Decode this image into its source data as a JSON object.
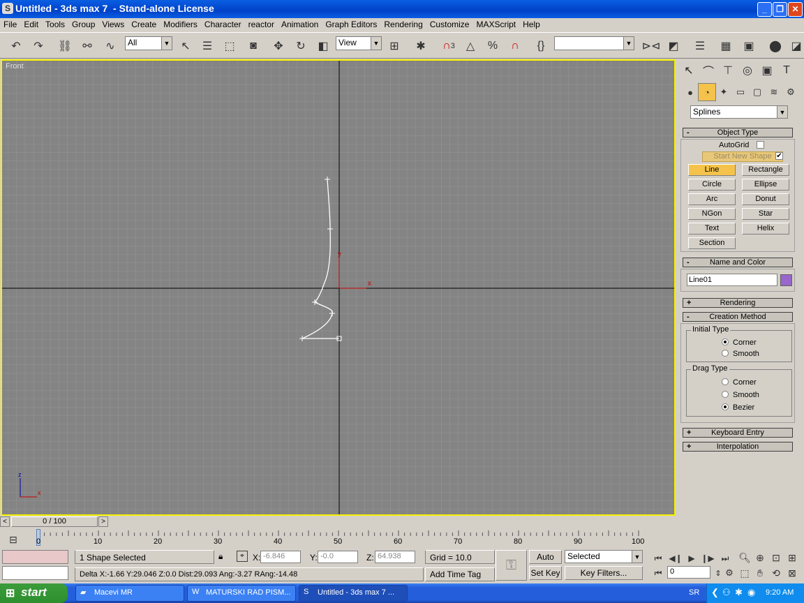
{
  "window": {
    "title": "Untitled - 3ds max 7  - Stand-alone License",
    "minimize": "_",
    "maximize": "❐",
    "close": "✕"
  },
  "menu": [
    "File",
    "Edit",
    "Tools",
    "Group",
    "Views",
    "Create",
    "Modifiers",
    "Character",
    "reactor",
    "Animation",
    "Graph Editors",
    "Rendering",
    "Customize",
    "MAXScript",
    "Help"
  ],
  "toolbar": {
    "selection_filter": "All",
    "reference_coord": "View",
    "snap_label": "3",
    "angle_snap": "%",
    "named_selection": ""
  },
  "viewport": {
    "label": "Front",
    "axis_x": "x",
    "axis_y": "y",
    "corner_z": "z",
    "corner_x": "x"
  },
  "panel": {
    "category": "Splines",
    "object_type": {
      "header": "Object Type",
      "autogrid": "AutoGrid",
      "start_new_shape": "Start New Shape",
      "start_new_shape_checked": true,
      "buttons": [
        "Line",
        "Rectangle",
        "Circle",
        "Ellipse",
        "Arc",
        "Donut",
        "NGon",
        "Star",
        "Text",
        "Helix",
        "Section"
      ],
      "active": "Line"
    },
    "name_color": {
      "header": "Name and Color",
      "name": "Line01",
      "color": "#9966cc"
    },
    "rendering": "Rendering",
    "creation_method": {
      "header": "Creation Method",
      "initial_type_label": "Initial Type",
      "initial_options": [
        "Corner",
        "Smooth"
      ],
      "initial_selected": "Corner",
      "drag_type_label": "Drag Type",
      "drag_options": [
        "Corner",
        "Smooth",
        "Bezier"
      ],
      "drag_selected": "Bezier"
    },
    "keyboard_entry": "Keyboard Entry",
    "interpolation": "Interpolation"
  },
  "timeline": {
    "frame": "0 / 100",
    "ticks": [
      "0",
      "10",
      "20",
      "30",
      "40",
      "50",
      "60",
      "70",
      "80",
      "90",
      "100"
    ]
  },
  "status": {
    "selection": "1 Shape Selected",
    "prompt": "Delta X:-1.66  Y:29.046  Z:0.0  Dist:29.093 Ang:-3.27 RAng:-14.48",
    "x_label": "X:",
    "x_value": "-6.846",
    "y_label": "Y:",
    "y_value": "-0.0",
    "z_label": "Z:",
    "z_value": "64.938",
    "grid": "Grid = 10.0",
    "add_time_tag": "Add Time Tag",
    "auto_key": "Auto Key",
    "set_key": "Set Key",
    "key_mode": "Selected",
    "key_filters": "Key Filters...",
    "current_frame": "0"
  },
  "taskbar": {
    "start": "start",
    "tasks": [
      "Macevi MR",
      "MATURSKI RAD PISM...",
      "Untitled - 3ds max 7  ..."
    ],
    "lang": "SR",
    "clock": "9:20 AM"
  }
}
